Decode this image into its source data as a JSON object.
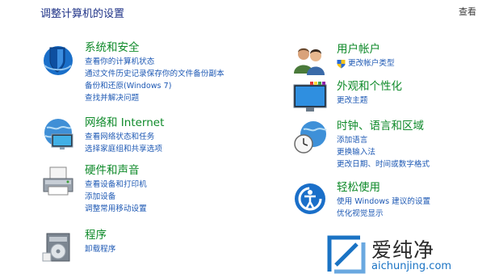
{
  "page": {
    "title": "调整计算机的设置",
    "view_by": "查看"
  },
  "categories": [
    {
      "heading": "系统和安全",
      "links": [
        "查看你的计算机状态",
        "通过文件历史记录保存你的文件备份副本",
        "备份和还原(Windows 7)",
        "查找并解决问题"
      ]
    },
    {
      "heading": "网络和 Internet",
      "links": [
        "查看网络状态和任务",
        "选择家庭组和共享选项"
      ]
    },
    {
      "heading": "硬件和声音",
      "links": [
        "查看设备和打印机",
        "添加设备",
        "调整常用移动设置"
      ]
    },
    {
      "heading": "程序",
      "links": [
        "卸载程序"
      ]
    },
    {
      "heading": "用户帐户",
      "links": [
        "更改帐户类型"
      ]
    },
    {
      "heading": "外观和个性化",
      "links": [
        "更改主题"
      ]
    },
    {
      "heading": "时钟、语言和区域",
      "links": [
        "添加语言",
        "更换输入法",
        "更改日期、时间或数字格式"
      ]
    },
    {
      "heading": "轻松使用",
      "links": [
        "使用 Windows 建议的设置",
        "优化视觉显示"
      ]
    }
  ],
  "watermark": {
    "title": "爱纯净",
    "domain": "aichunjing.com"
  },
  "colors": {
    "heading": "#0f8a2a",
    "link": "#1e59b4",
    "page_title": "#1e3287"
  }
}
